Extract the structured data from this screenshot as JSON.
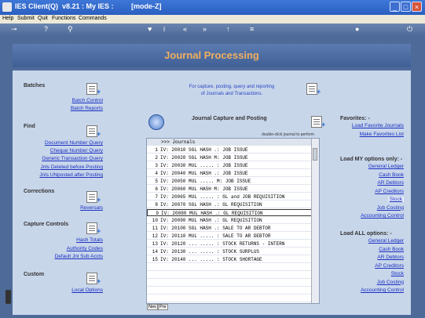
{
  "window": {
    "title": "IES Client(Q)  v8.21 : My IES :         [mode-Z]",
    "buttons": [
      "_",
      "□",
      "×"
    ]
  },
  "menu": [
    "Help",
    "Submit",
    "Quit",
    "Functions",
    "Commands"
  ],
  "banner": {
    "title": "Journal Processing"
  },
  "left": {
    "batches": {
      "title": "Batches",
      "links": [
        "Batch Control",
        "Batch Reports"
      ]
    },
    "find": {
      "title": "Find",
      "links": [
        "Document Number Query",
        "Cheque Number Query",
        "Generic Transaction Query",
        "Jnls Deleted before Posting",
        "Jnls UNposted after Posting"
      ]
    },
    "corrections": {
      "title": "Corrections",
      "links": [
        "Reversals"
      ]
    },
    "capture": {
      "title": "Capture Controls",
      "links": [
        "Hash Totals",
        "Authority Codes",
        "Default Jnl Sub Accts"
      ]
    },
    "custom": {
      "title": "Custom",
      "links": [
        "Local Options"
      ]
    }
  },
  "center": {
    "info_line1": "For capture, posting, query and reporting",
    "info_line2": "of Journals and Transactions.",
    "capture_title": "Journal Capture and Posting",
    "capture_hint": "double-click journal to perform",
    "list_header": ">>> Journals",
    "journals": [
      {
        "n": "1",
        "t": "IV: 20010 SGL HASH .: JOB ISSUE"
      },
      {
        "n": "2",
        "t": "IV: 20020 SGL HASH M: JOB ISSUE"
      },
      {
        "n": "3",
        "t": "IV: 20030 MUL ..... : JOB ISSUE"
      },
      {
        "n": "4",
        "t": "IV: 20040 MUL HASH .: JOB ISSUE"
      },
      {
        "n": "5",
        "t": "IV: 20050 MUL ..... M: JOB ISSUE"
      },
      {
        "n": "6",
        "t": "IV: 20060 MUL HASH M: JOB ISSUE"
      },
      {
        "n": "7",
        "t": "IV: 20065 MUL ..... : GL and JOB REQUISITION"
      },
      {
        "n": "8",
        "t": "IV: 20070 SGL HASH .: GL REQUISITION"
      },
      {
        "n": "9",
        "t": "IV: 20080 MUL HASH .: GL REQUISITION"
      },
      {
        "n": "10",
        "t": "IV: 20090 MUL HASH .: GL REQUISITION"
      },
      {
        "n": "11",
        "t": "IV: 20100 SGL HASH .: SALE TO AR DEBTOR"
      },
      {
        "n": "12",
        "t": "IV: 20110 MUL ..... : SALE TO AR DEBTOR"
      },
      {
        "n": "13",
        "t": "IV: 20120 ... ..... : STOCK RETURNS - INTERN"
      },
      {
        "n": "14",
        "t": "IV: 20130 ... ..... : STOCK SURPLUS"
      },
      {
        "n": "15",
        "t": "IV: 20140 ... ..... : STOCK SHORTAGE"
      }
    ],
    "nav": [
      "Nex",
      "Pre"
    ]
  },
  "right": {
    "favorites": {
      "title": "Favorites: -",
      "links": [
        "Load Favorite Journals",
        "Make Favorites List"
      ]
    },
    "my_options": {
      "title": "Load MY options only: -",
      "links": [
        "General Ledger",
        "Cash Book",
        "AR Debtors",
        "AP Creditors",
        "Stock",
        "Job Costing",
        "Accounting Control"
      ]
    },
    "all_options": {
      "title": "Load ALL options: -",
      "links": [
        "General Ledger",
        "Cash Book",
        "AR Debtors",
        "AP Creditors",
        "Stock",
        "Job Costing",
        "Accounting Control"
      ]
    }
  }
}
